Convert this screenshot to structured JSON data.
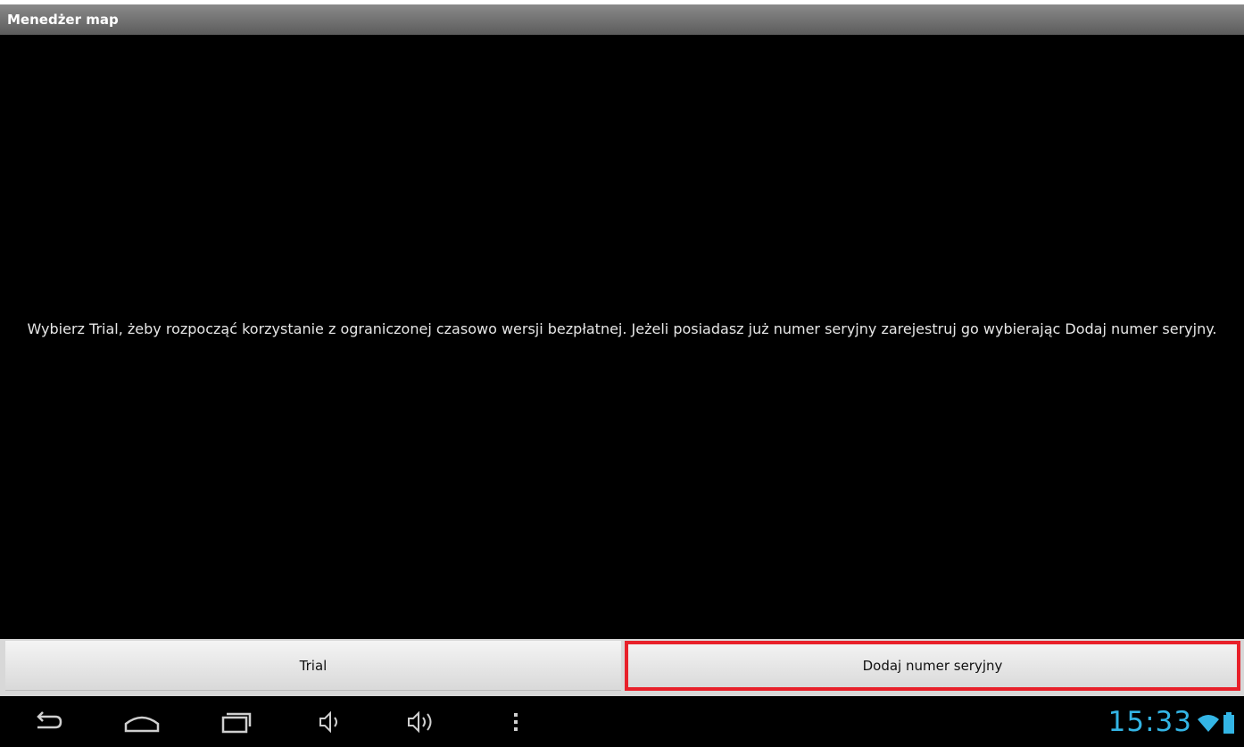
{
  "app": {
    "title": "Menedżer map"
  },
  "main": {
    "message": "Wybierz Trial, żeby rozpocząć korzystanie z ograniczonej czasowo wersji bezpłatnej. Jeżeli posiadasz już numer seryjny zarejestruj go wybierając Dodaj numer seryjny."
  },
  "buttons": {
    "trial_label": "Trial",
    "add_serial_label": "Dodaj numer seryjny"
  },
  "status_bar": {
    "time": "15:33",
    "icons": [
      "wifi-icon",
      "battery-icon"
    ],
    "accent_color": "#33b5e5"
  },
  "nav_bar": {
    "icons": [
      "back-icon",
      "home-icon",
      "recent-apps-icon",
      "volume-down-icon",
      "volume-up-icon",
      "menu-icon"
    ]
  },
  "highlight": {
    "color": "#e8202a"
  }
}
